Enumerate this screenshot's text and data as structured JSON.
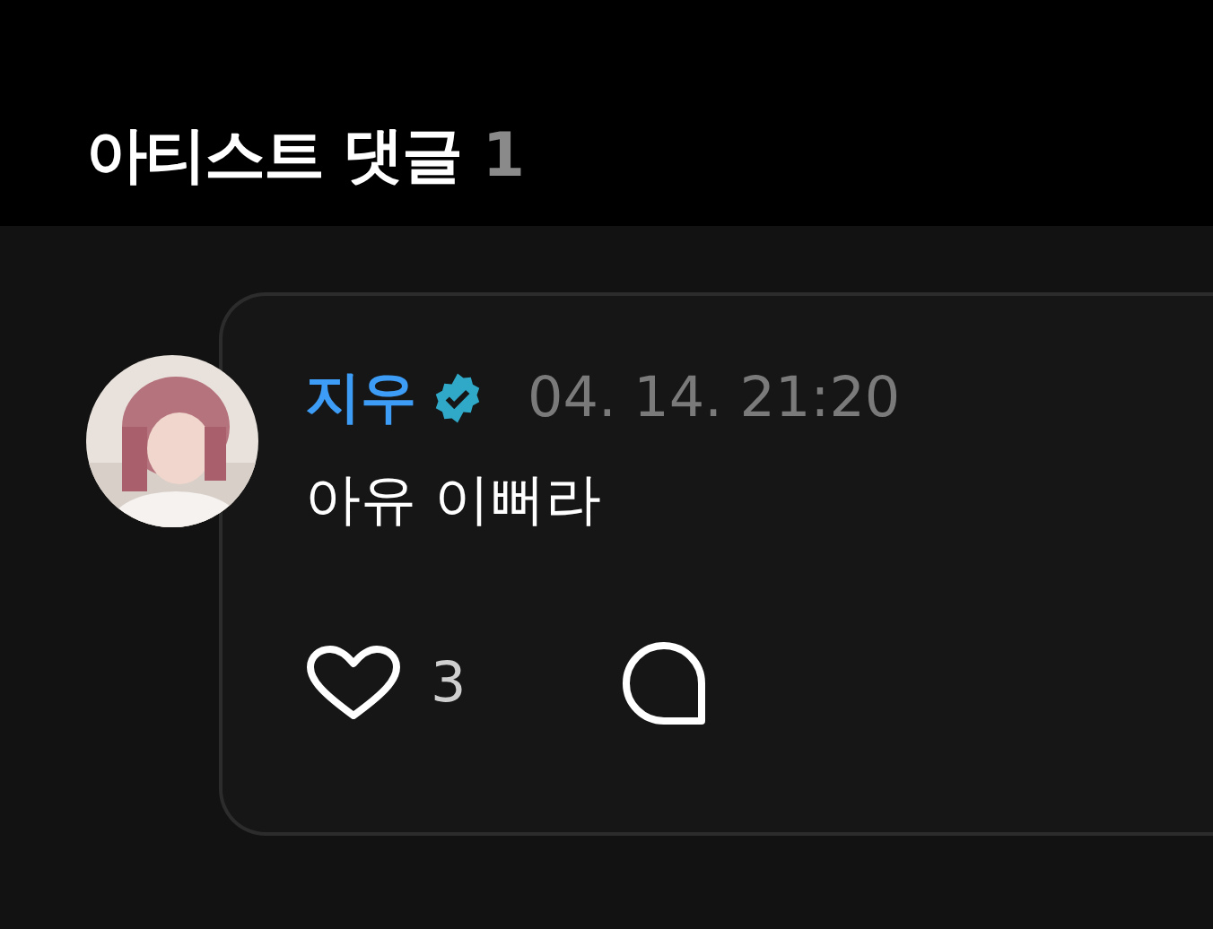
{
  "header": {
    "title": "아티스트 댓글",
    "count": "1"
  },
  "comment": {
    "author": "지우",
    "verified": true,
    "date": "04. 14. 21:20",
    "text": "아유 이뻐라",
    "likes": "3",
    "liked": false
  }
}
